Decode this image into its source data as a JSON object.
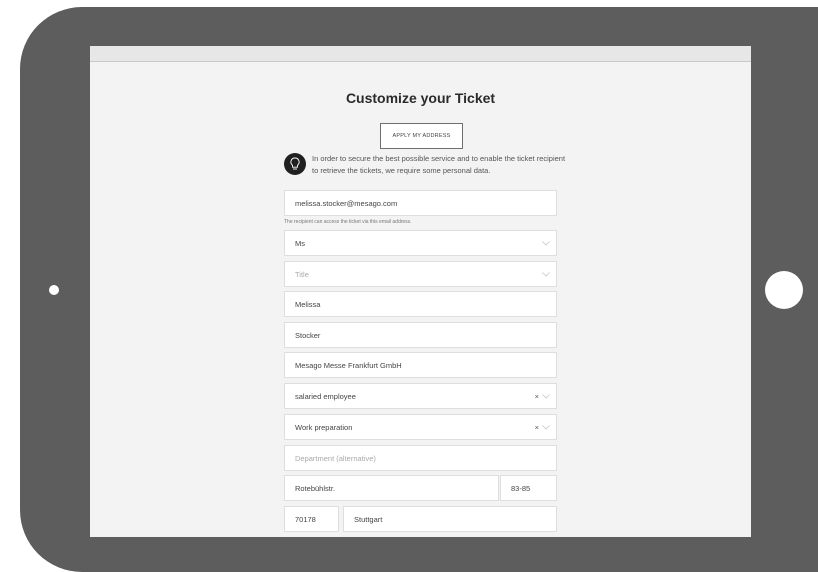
{
  "page": {
    "title": "Customize your Ticket",
    "apply_button": "APPLY MY ADDRESS",
    "info_text": "In order to secure the best possible service and to enable the ticket recipient to retrieve the tickets, we require some personal data."
  },
  "form": {
    "email": "melissa.stocker@mesago.com",
    "email_hint": "The recipient can access the ticket via this email address.",
    "salutation": "Ms",
    "title_placeholder": "Title",
    "first_name": "Melissa",
    "last_name": "Stocker",
    "company": "Mesago Messe Frankfurt GmbH",
    "position": "salaried employee",
    "department": "Work preparation",
    "department_alt_placeholder": "Department (alternative)",
    "street": "Rotebühlstr.",
    "house_number": "83-85",
    "zip": "70178",
    "city": "Stuttgart",
    "clear_symbol": "×"
  },
  "icons": {
    "info": "lightbulb-icon",
    "dropdown": "chevron-down-icon"
  }
}
